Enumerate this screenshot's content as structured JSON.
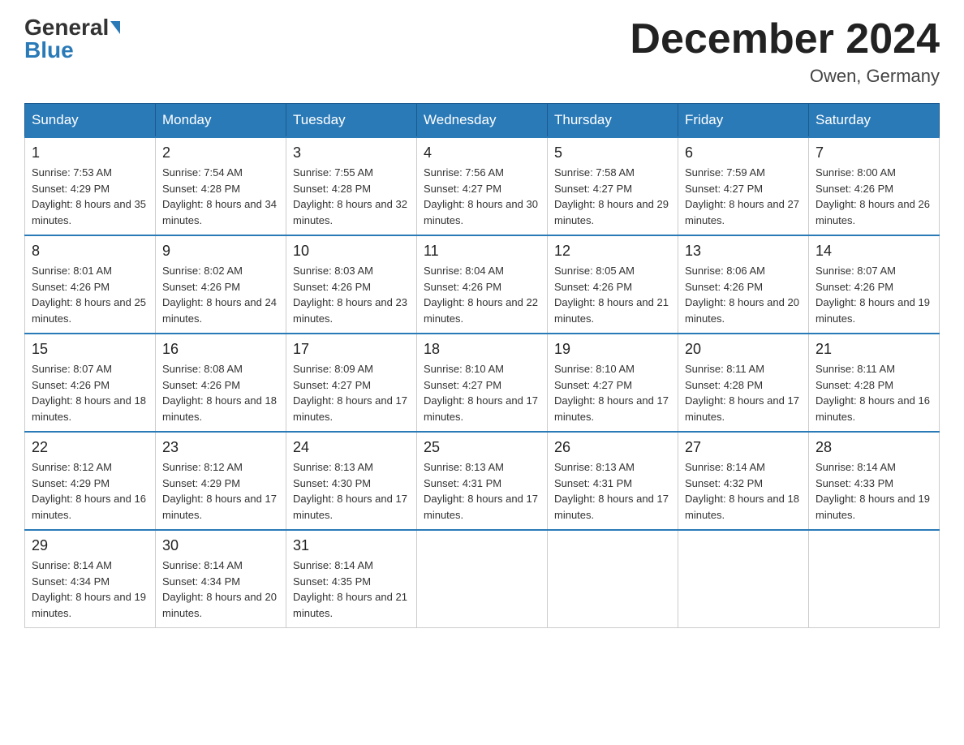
{
  "header": {
    "logo_general": "General",
    "logo_blue": "Blue",
    "month_title": "December 2024",
    "location": "Owen, Germany"
  },
  "weekdays": [
    "Sunday",
    "Monday",
    "Tuesday",
    "Wednesday",
    "Thursday",
    "Friday",
    "Saturday"
  ],
  "weeks": [
    [
      {
        "day": "1",
        "sunrise": "7:53 AM",
        "sunset": "4:29 PM",
        "daylight": "8 hours and 35 minutes."
      },
      {
        "day": "2",
        "sunrise": "7:54 AM",
        "sunset": "4:28 PM",
        "daylight": "8 hours and 34 minutes."
      },
      {
        "day": "3",
        "sunrise": "7:55 AM",
        "sunset": "4:28 PM",
        "daylight": "8 hours and 32 minutes."
      },
      {
        "day": "4",
        "sunrise": "7:56 AM",
        "sunset": "4:27 PM",
        "daylight": "8 hours and 30 minutes."
      },
      {
        "day": "5",
        "sunrise": "7:58 AM",
        "sunset": "4:27 PM",
        "daylight": "8 hours and 29 minutes."
      },
      {
        "day": "6",
        "sunrise": "7:59 AM",
        "sunset": "4:27 PM",
        "daylight": "8 hours and 27 minutes."
      },
      {
        "day": "7",
        "sunrise": "8:00 AM",
        "sunset": "4:26 PM",
        "daylight": "8 hours and 26 minutes."
      }
    ],
    [
      {
        "day": "8",
        "sunrise": "8:01 AM",
        "sunset": "4:26 PM",
        "daylight": "8 hours and 25 minutes."
      },
      {
        "day": "9",
        "sunrise": "8:02 AM",
        "sunset": "4:26 PM",
        "daylight": "8 hours and 24 minutes."
      },
      {
        "day": "10",
        "sunrise": "8:03 AM",
        "sunset": "4:26 PM",
        "daylight": "8 hours and 23 minutes."
      },
      {
        "day": "11",
        "sunrise": "8:04 AM",
        "sunset": "4:26 PM",
        "daylight": "8 hours and 22 minutes."
      },
      {
        "day": "12",
        "sunrise": "8:05 AM",
        "sunset": "4:26 PM",
        "daylight": "8 hours and 21 minutes."
      },
      {
        "day": "13",
        "sunrise": "8:06 AM",
        "sunset": "4:26 PM",
        "daylight": "8 hours and 20 minutes."
      },
      {
        "day": "14",
        "sunrise": "8:07 AM",
        "sunset": "4:26 PM",
        "daylight": "8 hours and 19 minutes."
      }
    ],
    [
      {
        "day": "15",
        "sunrise": "8:07 AM",
        "sunset": "4:26 PM",
        "daylight": "8 hours and 18 minutes."
      },
      {
        "day": "16",
        "sunrise": "8:08 AM",
        "sunset": "4:26 PM",
        "daylight": "8 hours and 18 minutes."
      },
      {
        "day": "17",
        "sunrise": "8:09 AM",
        "sunset": "4:27 PM",
        "daylight": "8 hours and 17 minutes."
      },
      {
        "day": "18",
        "sunrise": "8:10 AM",
        "sunset": "4:27 PM",
        "daylight": "8 hours and 17 minutes."
      },
      {
        "day": "19",
        "sunrise": "8:10 AM",
        "sunset": "4:27 PM",
        "daylight": "8 hours and 17 minutes."
      },
      {
        "day": "20",
        "sunrise": "8:11 AM",
        "sunset": "4:28 PM",
        "daylight": "8 hours and 17 minutes."
      },
      {
        "day": "21",
        "sunrise": "8:11 AM",
        "sunset": "4:28 PM",
        "daylight": "8 hours and 16 minutes."
      }
    ],
    [
      {
        "day": "22",
        "sunrise": "8:12 AM",
        "sunset": "4:29 PM",
        "daylight": "8 hours and 16 minutes."
      },
      {
        "day": "23",
        "sunrise": "8:12 AM",
        "sunset": "4:29 PM",
        "daylight": "8 hours and 17 minutes."
      },
      {
        "day": "24",
        "sunrise": "8:13 AM",
        "sunset": "4:30 PM",
        "daylight": "8 hours and 17 minutes."
      },
      {
        "day": "25",
        "sunrise": "8:13 AM",
        "sunset": "4:31 PM",
        "daylight": "8 hours and 17 minutes."
      },
      {
        "day": "26",
        "sunrise": "8:13 AM",
        "sunset": "4:31 PM",
        "daylight": "8 hours and 17 minutes."
      },
      {
        "day": "27",
        "sunrise": "8:14 AM",
        "sunset": "4:32 PM",
        "daylight": "8 hours and 18 minutes."
      },
      {
        "day": "28",
        "sunrise": "8:14 AM",
        "sunset": "4:33 PM",
        "daylight": "8 hours and 19 minutes."
      }
    ],
    [
      {
        "day": "29",
        "sunrise": "8:14 AM",
        "sunset": "4:34 PM",
        "daylight": "8 hours and 19 minutes."
      },
      {
        "day": "30",
        "sunrise": "8:14 AM",
        "sunset": "4:34 PM",
        "daylight": "8 hours and 20 minutes."
      },
      {
        "day": "31",
        "sunrise": "8:14 AM",
        "sunset": "4:35 PM",
        "daylight": "8 hours and 21 minutes."
      },
      null,
      null,
      null,
      null
    ]
  ]
}
